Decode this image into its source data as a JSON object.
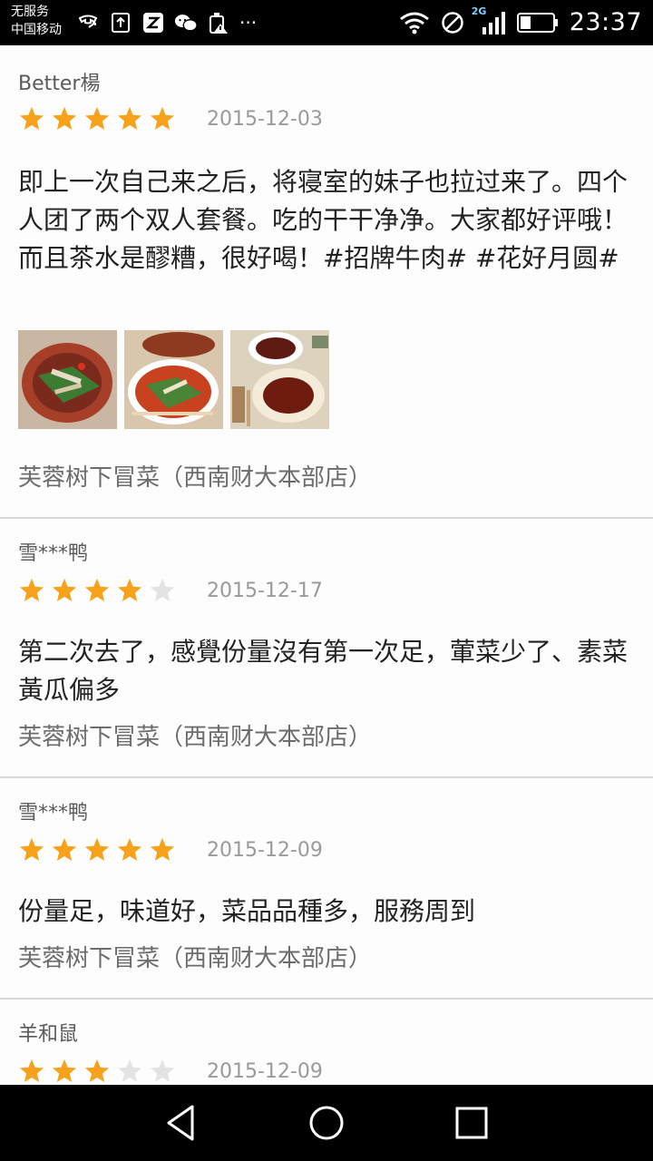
{
  "status_bar": {
    "carrier_line1": "无服务",
    "carrier_line2": "中国移动",
    "network_type": "2G",
    "time": "23:37",
    "more_glyph": "···"
  },
  "colors": {
    "star_filled": "#f7a21a",
    "star_empty": "#e3e3e3"
  },
  "reviews": [
    {
      "user": "Better楊",
      "rating": 5,
      "date": "2015-12-03",
      "content": "即上一次自己来之后，将寝室的妹子也拉过来了。四个人团了两个双人套餐。吃的干干净净。大家都好评哦！而且茶水是醪糟，很好喝！#招牌牛肉#  #花好月圆#",
      "photo_count": 3,
      "shop": "芙蓉树下冒菜（西南财大本部店）"
    },
    {
      "user": "雪***鸭",
      "rating": 4,
      "date": "2015-12-17",
      "content": "第二次去了，感覺份量沒有第一次足，葷菜少了、素菜黃瓜偏多",
      "shop": "芙蓉树下冒菜（西南财大本部店）"
    },
    {
      "user": "雪***鸭",
      "rating": 5,
      "date": "2015-12-09",
      "content": "份量足，味道好，菜品品種多，服務周到",
      "shop": "芙蓉树下冒菜（西南财大本部店）"
    },
    {
      "user": "羊和鼠",
      "rating": 3,
      "date": "2015-12-09"
    }
  ]
}
